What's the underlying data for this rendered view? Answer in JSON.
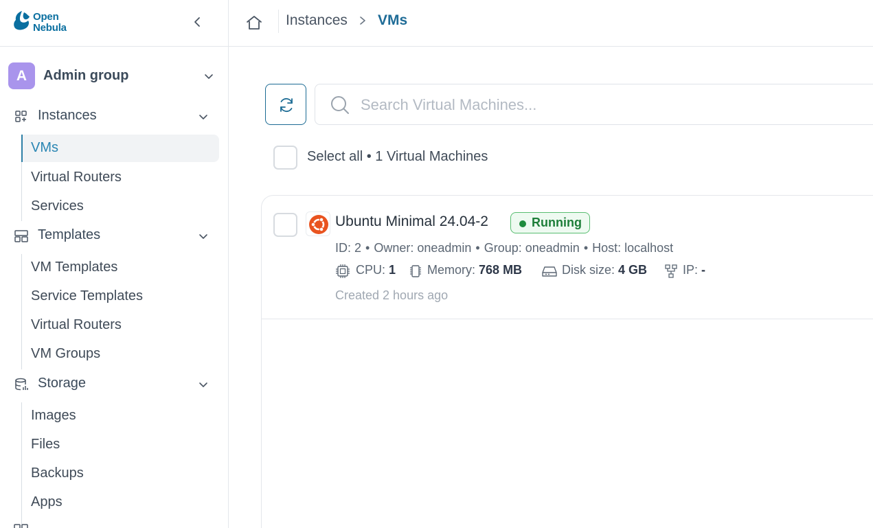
{
  "brand": {
    "line1": "Open",
    "line2": "Nebula",
    "color": "#0a6fa0"
  },
  "sidebar": {
    "group": {
      "avatar_letter": "A",
      "name": "Admin group"
    },
    "sections": [
      {
        "label": "Instances",
        "icon": "instances-icon",
        "items": [
          {
            "label": "VMs",
            "active": true
          },
          {
            "label": "Virtual Routers"
          },
          {
            "label": "Services"
          }
        ]
      },
      {
        "label": "Templates",
        "icon": "templates-icon",
        "items": [
          {
            "label": "VM Templates"
          },
          {
            "label": "Service Templates"
          },
          {
            "label": "Virtual Routers"
          },
          {
            "label": "VM Groups"
          }
        ]
      },
      {
        "label": "Storage",
        "icon": "storage-icon",
        "items": [
          {
            "label": "Images"
          },
          {
            "label": "Files"
          },
          {
            "label": "Backups"
          },
          {
            "label": "Apps"
          }
        ]
      }
    ]
  },
  "breadcrumb": {
    "parent": "Instances",
    "current": "VMs"
  },
  "search": {
    "placeholder": "Search Virtual Machines..."
  },
  "list": {
    "select_all": "Select all • 1 Virtual Machines"
  },
  "vms": [
    {
      "name": "Ubuntu Minimal 24.04-2",
      "status": "Running",
      "meta": {
        "id": "ID: 2",
        "owner": "Owner: oneadmin",
        "group": "Group: oneadmin",
        "host": "Host: localhost"
      },
      "cpu_label": "CPU:",
      "cpu_value": "1",
      "memory_label": "Memory:",
      "memory_value": "768 MB",
      "disk_label": "Disk size:",
      "disk_value": "4 GB",
      "ip_label": "IP:",
      "ip_value": "-",
      "created": "Created 2 hours ago"
    }
  ],
  "colors": {
    "accent": "#1a6a93",
    "running": "#1f8c3e",
    "avatar": "#a994ec",
    "ubuntu": "#e95420"
  }
}
